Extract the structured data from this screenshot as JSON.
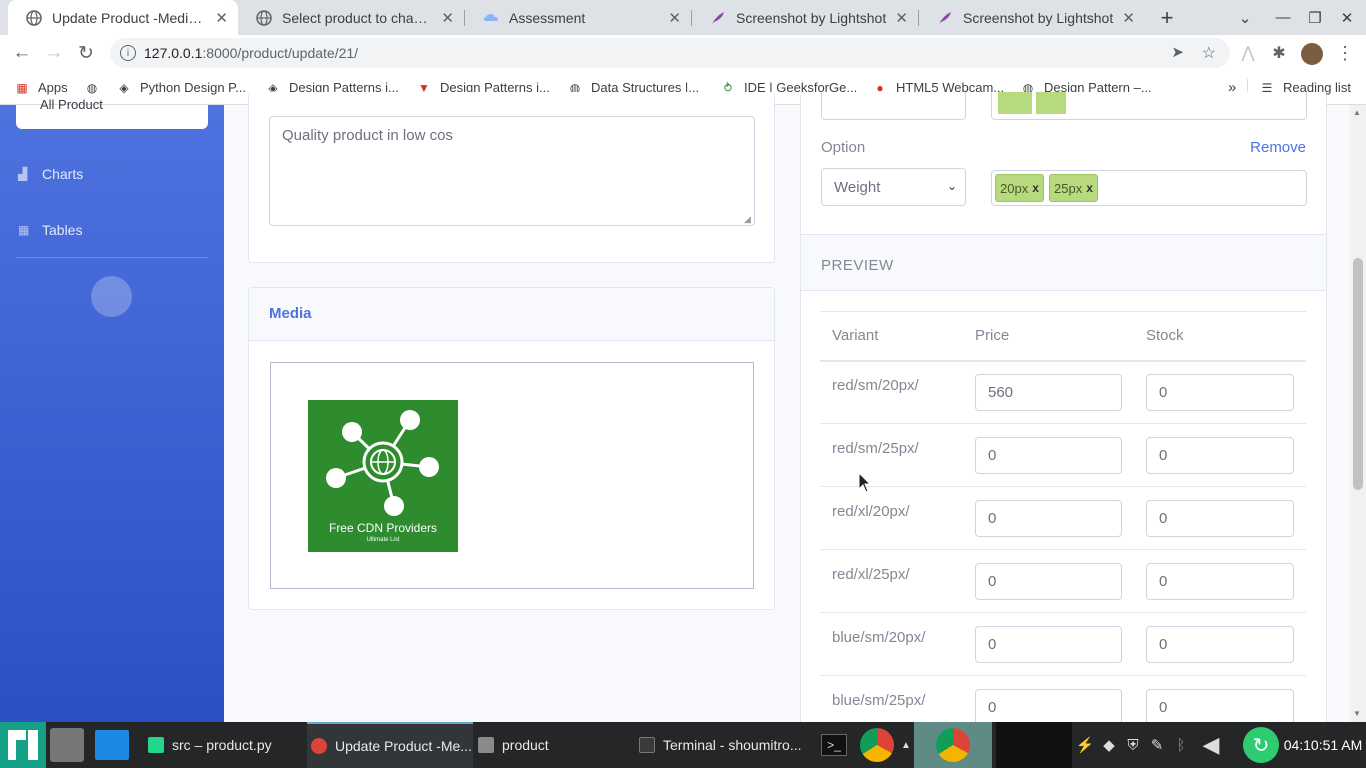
{
  "browser": {
    "tabs": [
      {
        "title": "Update Product -Mediuswa",
        "active": true
      },
      {
        "title": "Select product to change |",
        "active": false
      },
      {
        "title": "Assessment",
        "active": false
      },
      {
        "title": "Screenshot by Lightshot",
        "active": false
      },
      {
        "title": "Screenshot by Lightshot",
        "active": false
      }
    ],
    "new_tab_label": "+",
    "url_host": "127.0.0.1",
    "url_path": ":8000/product/update/21/",
    "bookmarks": [
      {
        "label": "Apps"
      },
      {
        "label": ""
      },
      {
        "label": "Python Design P..."
      },
      {
        "label": "Design Patterns i..."
      },
      {
        "label": "Design Patterns i..."
      },
      {
        "label": "Data Structures |..."
      },
      {
        "label": "IDE | GeeksforGe..."
      },
      {
        "label": "HTML5 Webcam..."
      },
      {
        "label": "Design Pattern –..."
      }
    ],
    "more_bookmarks": "»",
    "reading_list": "Reading list"
  },
  "sidebar": {
    "items": [
      {
        "label": "Charts",
        "icon": "chart-area-icon"
      },
      {
        "label": "Tables",
        "icon": "table-icon"
      }
    ],
    "partial_link": "All Product"
  },
  "description": {
    "value": "Quality product in low cos"
  },
  "media": {
    "heading": "Media",
    "thumbnail_text": "Free CDN Providers",
    "thumbnail_subtext": "Ultimate List"
  },
  "variants": {
    "option_label": "Option",
    "remove_label": "Remove",
    "option_select": "Weight",
    "tags": [
      "20px",
      "25px"
    ]
  },
  "preview": {
    "heading": "PREVIEW",
    "columns": [
      "Variant",
      "Price",
      "Stock"
    ],
    "rows": [
      {
        "variant": "red/sm/20px/",
        "price": "560",
        "stock": "0"
      },
      {
        "variant": "red/sm/25px/",
        "price": "0",
        "stock": "0"
      },
      {
        "variant": "red/xl/20px/",
        "price": "0",
        "stock": "0"
      },
      {
        "variant": "red/xl/25px/",
        "price": "0",
        "stock": "0"
      },
      {
        "variant": "blue/sm/20px/",
        "price": "0",
        "stock": "0"
      },
      {
        "variant": "blue/sm/25px/",
        "price": "0",
        "stock": "0"
      }
    ]
  },
  "taskbar": {
    "items": [
      {
        "label": "src – product.py"
      },
      {
        "label": "Update Product -Me..."
      },
      {
        "label": "product"
      },
      {
        "label": "Terminal - shoumitro..."
      }
    ],
    "clock": "04:10:51 AM"
  },
  "colors": {
    "sidebar": "#4e73df",
    "accent": "#4e73df",
    "tag": "#b8da7e",
    "thumbnail": "#2e8b2e"
  }
}
